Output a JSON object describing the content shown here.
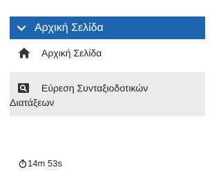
{
  "menu": {
    "header_label": "Αρχική Σελίδα",
    "items": [
      {
        "label": "Αρχική Σελίδα",
        "icon": "home-icon"
      },
      {
        "label_line1": "Εύρεση Συνταξιοδοτικών",
        "label_line2": "Διατάξεων",
        "icon": "search-icon"
      }
    ]
  },
  "colors": {
    "header_bg": "#1c64ae",
    "selected_bg": "#ebebeb"
  },
  "session": {
    "timer_text": "14m 53s",
    "icon": "stopwatch-icon"
  }
}
